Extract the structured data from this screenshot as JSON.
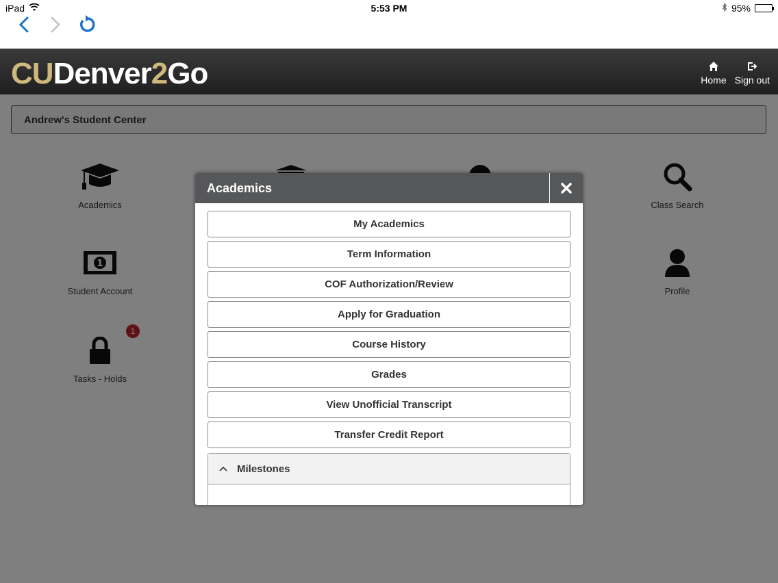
{
  "status_bar": {
    "device": "iPad",
    "time": "5:53 PM",
    "battery": "95%",
    "battery_level": 0.95
  },
  "header": {
    "logo": {
      "part1": "CU",
      "part2": "Denver",
      "part3": "2",
      "part4": "Go"
    },
    "home_label": "Home",
    "signout_label": "Sign out"
  },
  "center_title": "Andrew's Student Center",
  "tiles": {
    "academics": "Academics",
    "class_search": "Class Search",
    "student_account": "Student Account",
    "profile": "Profile",
    "tasks_holds": "Tasks - Holds",
    "tasks_badge": "1"
  },
  "modal": {
    "title": "Academics",
    "buttons": [
      "My Academics",
      "Term Information",
      "COF Authorization/Review",
      "Apply for Graduation",
      "Course History",
      "Grades",
      "View Unofficial Transcript",
      "Transfer Credit Report"
    ],
    "milestones_label": "Milestones"
  },
  "colors": {
    "brand_gold": "#cfb87c",
    "header_dark": "#2a2a2a",
    "modal_header": "#555758",
    "badge_red": "#c0272d",
    "ios_blue": "#1a73c8"
  }
}
